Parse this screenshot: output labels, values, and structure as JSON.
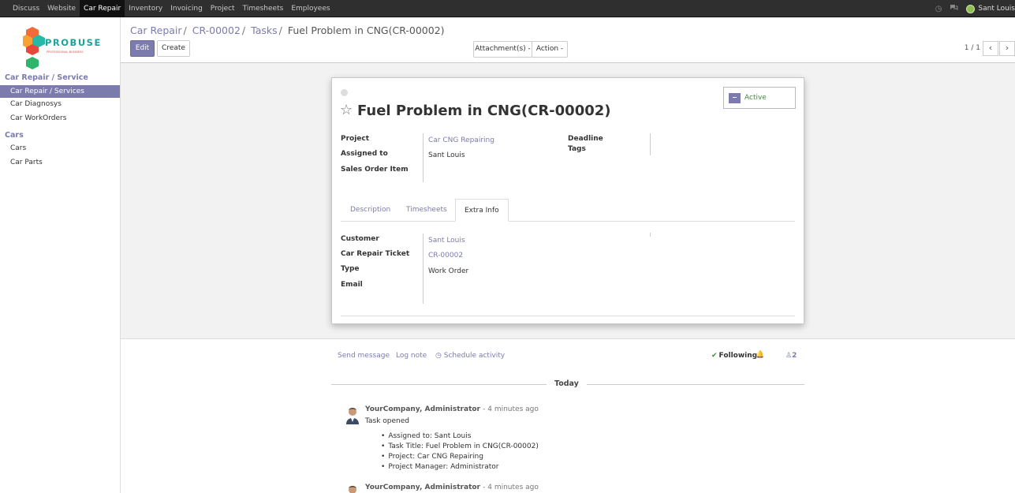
{
  "topbar": {
    "menu": [
      "Discuss",
      "Website",
      "Car Repair",
      "Inventory",
      "Invoicing",
      "Project",
      "Timesheets",
      "Employees"
    ],
    "active_menu": "Car Repair",
    "user_name": "Sant Louis"
  },
  "sidebar": {
    "logo_text": "PROBUSE",
    "logo_subtext": "PROFESSIONAL BUSINESS",
    "sections": [
      {
        "title": "Car Repair / Service",
        "items": [
          "Car Repair / Services",
          "Car Diagnosys",
          "Car WorkOrders"
        ]
      },
      {
        "title": "Cars",
        "items": [
          "Cars",
          "Car Parts"
        ]
      }
    ],
    "active_item": "Car Repair / Services"
  },
  "control_panel": {
    "breadcrumb": [
      "Car Repair",
      "CR-00002",
      "Tasks",
      "Fuel Problem in CNG(CR-00002)"
    ],
    "edit_label": "Edit",
    "create_label": "Create",
    "attachments_label": "Attachment(s) -",
    "action_label": "Action -",
    "pager": "1 / 1"
  },
  "form": {
    "title": "Fuel Problem in CNG(CR-00002)",
    "active_label": "Active",
    "fields": {
      "project_label": "Project",
      "project_value": "Car CNG Repairing",
      "assigned_label": "Assigned to",
      "assigned_value": "Sant Louis",
      "sales_order_label": "Sales Order Item",
      "deadline_label": "Deadline",
      "tags_label": "Tags"
    },
    "tabs": [
      "Description",
      "Timesheets",
      "Extra Info"
    ],
    "active_tab": "Extra Info",
    "extra": {
      "customer_label": "Customer",
      "customer_value": "Sant Louis",
      "ticket_label": "Car Repair Ticket",
      "ticket_value": "CR-00002",
      "type_label": "Type",
      "type_value": "Work Order",
      "email_label": "Email"
    }
  },
  "chatter": {
    "send_message": "Send message",
    "log_note": "Log note",
    "schedule_activity": "Schedule activity",
    "following": "Following",
    "followers_count": "2",
    "today_label": "Today",
    "messages": [
      {
        "author": "YourCompany, Administrator",
        "time": "- 4 minutes ago",
        "text": "Task opened",
        "changes": [
          "Assigned to: Sant Louis",
          "Task Title: Fuel Problem in CNG(CR-00002)",
          "Project: Car CNG Repairing",
          "Project Manager: Administrator"
        ]
      },
      {
        "author": "YourCompany, Administrator",
        "time": "- 4 minutes ago"
      }
    ]
  },
  "colors": {
    "accent": "#7c7bad",
    "navbar": "#2f2f2f",
    "active_green": "#3d8c3d"
  }
}
